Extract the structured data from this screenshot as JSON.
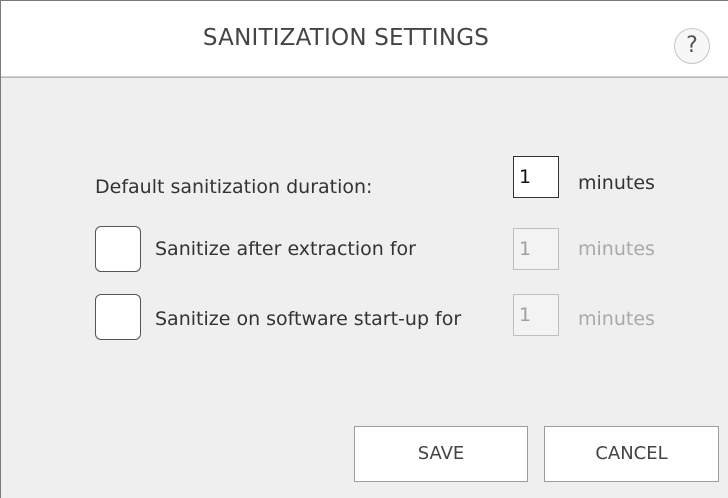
{
  "header": {
    "title": "SANITIZATION SETTINGS",
    "help_label": "?"
  },
  "settings": {
    "default_duration": {
      "label": "Default sanitization duration:",
      "value": "1",
      "unit": "minutes"
    },
    "after_extraction": {
      "label": "Sanitize after extraction for",
      "checked": false,
      "value": "1",
      "unit": "minutes",
      "enabled": false
    },
    "on_startup": {
      "label": "Sanitize on software start-up for",
      "checked": false,
      "value": "1",
      "unit": "minutes",
      "enabled": false
    }
  },
  "actions": {
    "save_label": "SAVE",
    "cancel_label": "CANCEL"
  },
  "colors": {
    "panel_background": "#efefef",
    "text": "#333333",
    "disabled_text": "#a9a9a9"
  }
}
